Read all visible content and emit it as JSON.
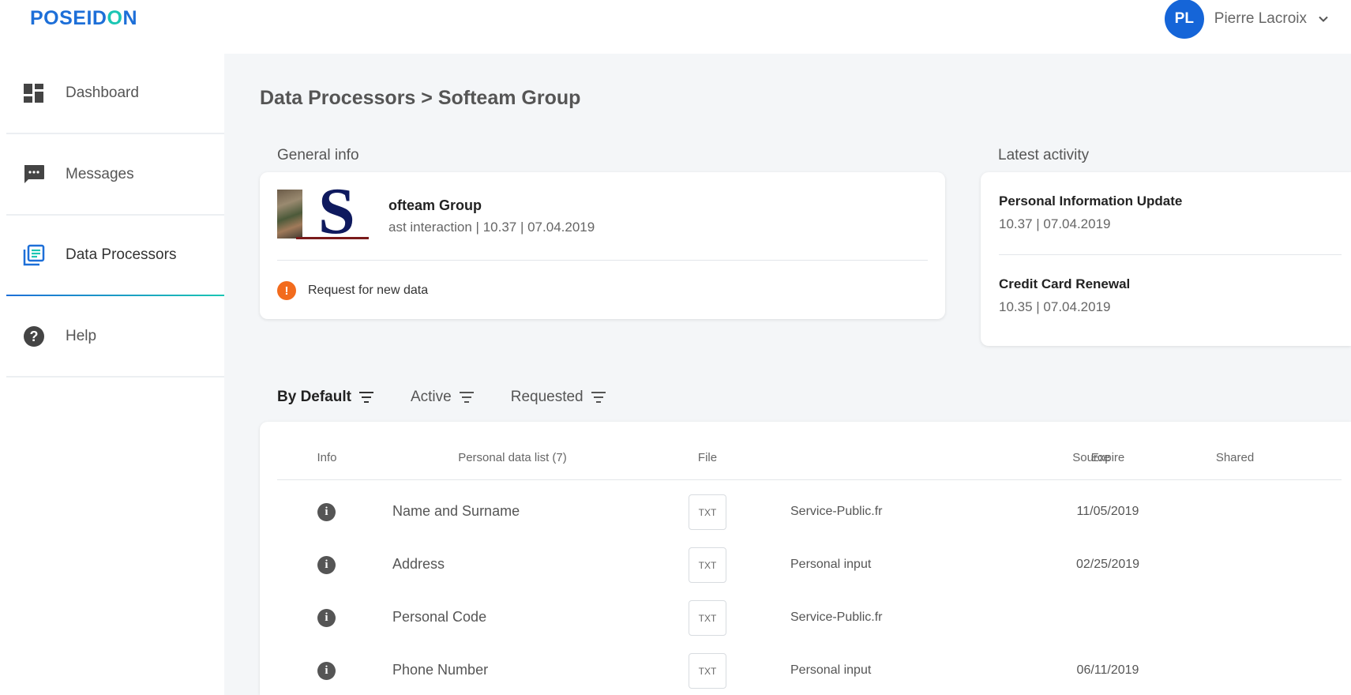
{
  "header": {
    "logo_part1": "POSEID",
    "logo_o": "O",
    "logo_part2": "N",
    "user_initials": "PL",
    "user_name": "Pierre Lacroix"
  },
  "sidebar": {
    "items": [
      {
        "label": "Dashboard",
        "icon": "dashboard-icon"
      },
      {
        "label": "Messages",
        "icon": "messages-icon"
      },
      {
        "label": "Data Processors",
        "icon": "data-processors-icon",
        "active": true
      },
      {
        "label": "Help",
        "icon": "help-icon"
      }
    ]
  },
  "page": {
    "title": "Data Processors > Softeam Group"
  },
  "general_info": {
    "section_label": "General info",
    "company_name": "ofteam Group",
    "last_interaction": "ast interaction | 10.37 | 07.04.2019",
    "logo_letter": "S",
    "alert_text": "Request for new data"
  },
  "latest_activity": {
    "section_label": "Latest activity",
    "items": [
      {
        "title": "Personal Information Update",
        "time": "10.37 | 07.04.2019"
      },
      {
        "title": "Credit Card Renewal",
        "time": "10.35 | 07.04.2019"
      }
    ]
  },
  "filters": [
    {
      "label": "By Default",
      "active": true
    },
    {
      "label": "Active"
    },
    {
      "label": "Requested"
    }
  ],
  "table": {
    "headers": {
      "info": "Info",
      "personal_data": "Personal data list (7)",
      "file": "File",
      "source": "Source",
      "expire": "Expire",
      "shared": "Shared"
    },
    "rows": [
      {
        "name": "Name and Surname",
        "file": "TXT",
        "source": "Service-Public.fr",
        "expire": "11/05/2019"
      },
      {
        "name": "Address",
        "file": "TXT",
        "source": "Personal input",
        "expire": "02/25/2019"
      },
      {
        "name": "Personal Code",
        "file": "TXT",
        "source": "Service-Public.fr",
        "expire": ""
      },
      {
        "name": "Phone Number",
        "file": "TXT",
        "source": "Personal input",
        "expire": "06/11/2019"
      }
    ]
  },
  "colors": {
    "brand_blue": "#1d6fd8",
    "brand_teal": "#1bc6b3",
    "alert_orange": "#f26b1d",
    "avatar_blue": "#1565d8"
  }
}
